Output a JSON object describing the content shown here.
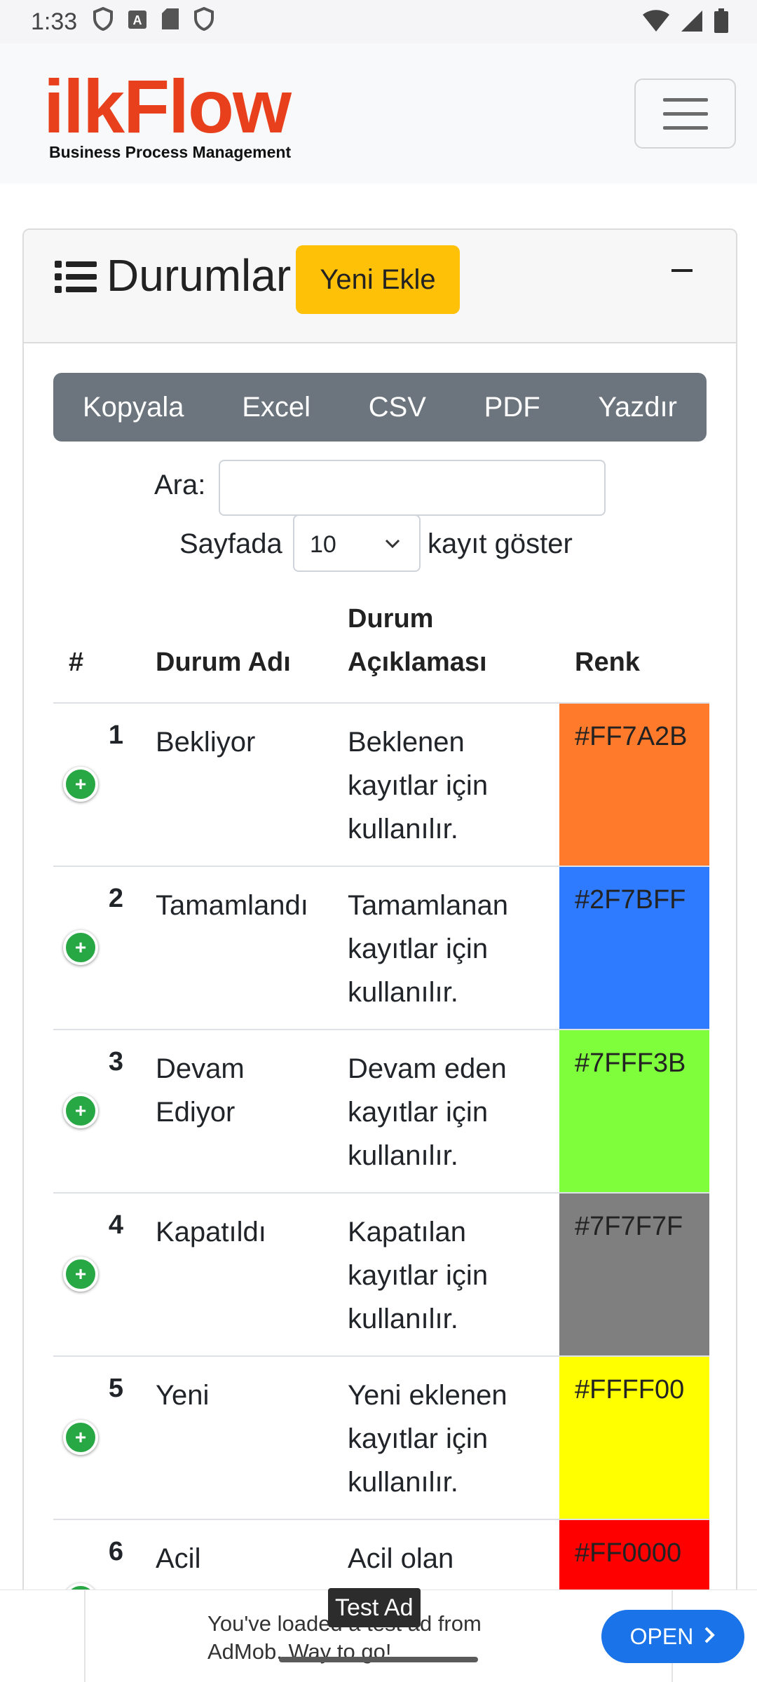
{
  "status_bar": {
    "time": "1:33"
  },
  "app": {
    "logo_text": "ilkFlow",
    "logo_subtitle": "Business Process Management"
  },
  "card": {
    "title": "Durumlar",
    "new_button": "Yeni Ekle"
  },
  "export_buttons": [
    "Kopyala",
    "Excel",
    "CSV",
    "PDF",
    "Yazdır"
  ],
  "search": {
    "label": "Ara:",
    "value": ""
  },
  "page_length": {
    "prefix": "Sayfada",
    "value": "10",
    "suffix": "kayıt göster"
  },
  "table": {
    "headers": {
      "number": "#",
      "name": "Durum Adı",
      "description": "Durum Açıklaması",
      "color": "Renk"
    },
    "rows": [
      {
        "number": "1",
        "name": "Bekliyor",
        "description": "Beklenen kayıtlar için kullanılır.",
        "color": "#FF7A2B"
      },
      {
        "number": "2",
        "name": "Tamamlandı",
        "description": "Tamamlanan kayıtlar için kullanılır.",
        "color": "#2F7BFF"
      },
      {
        "number": "3",
        "name": "Devam Ediyor",
        "description": "Devam eden kayıtlar için kullanılır.",
        "color": "#7FFF3B"
      },
      {
        "number": "4",
        "name": "Kapatıldı",
        "description": "Kapatılan kayıtlar için kullanılır.",
        "color": "#7F7F7F"
      },
      {
        "number": "5",
        "name": "Yeni",
        "description": "Yeni eklenen kayıtlar için kullanılır.",
        "color": "#FFFF00"
      },
      {
        "number": "6",
        "name": "Acil",
        "description": "Acil olan kayıtlar için kullanılır.",
        "color": "#FF0000"
      }
    ]
  },
  "ad": {
    "tag": "Test Ad",
    "text": "You've loaded a test ad from AdMob. Way to go!",
    "button": "OPEN"
  }
}
